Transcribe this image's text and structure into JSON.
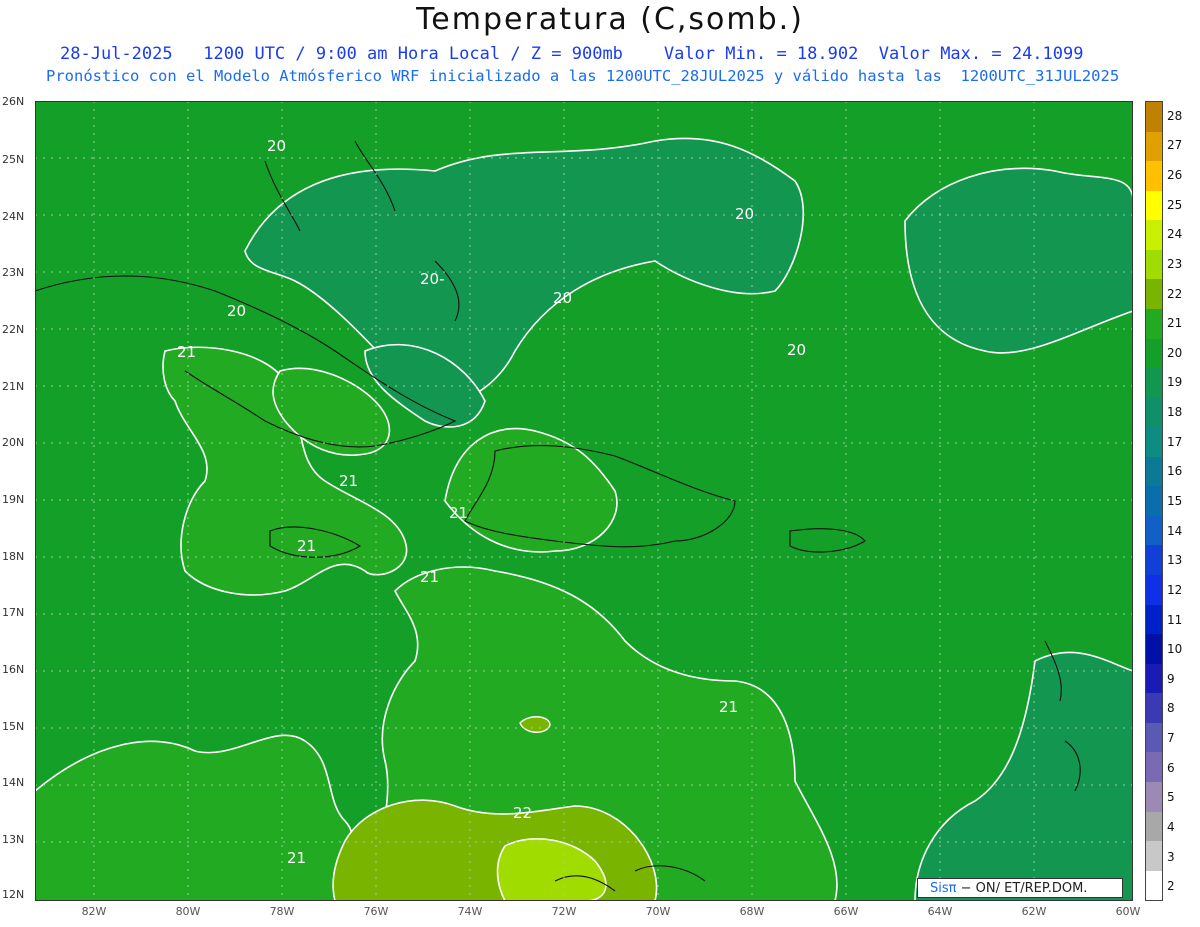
{
  "header": {
    "title": "Temperatura (C,somb.)",
    "line1": "28-Jul-2025   1200 UTC / 9:00 am Hora Local / Z = 900mb    Valor Min. = 18.902  Valor Max. = 24.1099",
    "line2": "Pronóstico con el Modelo Atmósferico WRF inicializado a las 1200UTC_28JUL2025 y válido hasta las  1200UTC_31JUL2025"
  },
  "axes": {
    "lat_labels": [
      "26N",
      "25N",
      "24N",
      "23N",
      "22N",
      "21N",
      "20N",
      "19N",
      "18N",
      "17N",
      "16N",
      "15N",
      "14N",
      "13N",
      "12N"
    ],
    "lon_labels": [
      "82W",
      "80W",
      "78W",
      "76W",
      "74W",
      "72W",
      "70W",
      "68W",
      "66W",
      "64W",
      "62W",
      "60W"
    ]
  },
  "contour_labels": [
    "20",
    "20",
    "20-",
    "20",
    "20",
    "20",
    "21",
    "21",
    "21",
    "21",
    "21",
    "21",
    "21",
    "22"
  ],
  "colorbar": {
    "labels": [
      "28",
      "27",
      "26",
      "25",
      "24",
      "23",
      "22",
      "21",
      "20",
      "19",
      "18",
      "17",
      "16",
      "15",
      "14",
      "13",
      "12",
      "11",
      "10",
      "9",
      "8",
      "7",
      "6",
      "5",
      "4",
      "3",
      "2"
    ],
    "colors": [
      "#c08000",
      "#e0a000",
      "#ffc000",
      "#ffff00",
      "#c8f000",
      "#a0dc00",
      "#78b400",
      "#22aa22",
      "#14a028",
      "#129650",
      "#10906a",
      "#0e8c82",
      "#0c7a96",
      "#0a6eaa",
      "#1060c8",
      "#1040d8",
      "#1030e8",
      "#0020c8",
      "#0010a8",
      "#1a1ab4",
      "#3a3ab4",
      "#5a5ab4",
      "#7a6ab4",
      "#9a8ab4",
      "#a8a8a8",
      "#c8c8c8",
      "#ffffff"
    ]
  },
  "credit": {
    "brand": "Sisπ",
    "text": "− ON/  ET/REP.DOM."
  }
}
